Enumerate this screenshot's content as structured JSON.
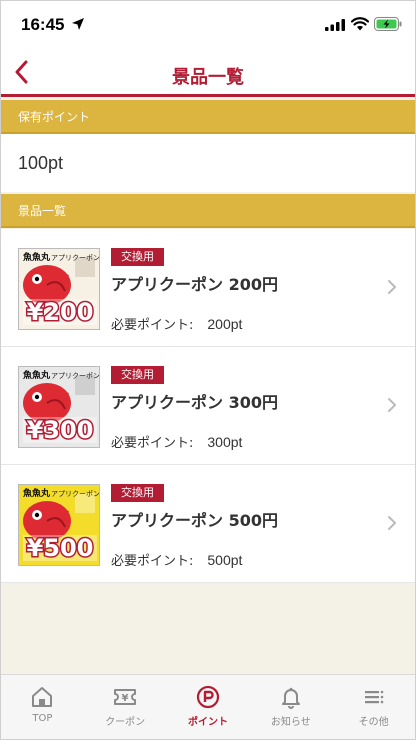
{
  "status_bar": {
    "time": "16:45"
  },
  "header": {
    "title": "景品一覧",
    "back_icon": "chevron-left-icon"
  },
  "points_section": {
    "label": "保有ポイント",
    "value": "100pt"
  },
  "prizes_section": {
    "label": "景品一覧",
    "items": [
      {
        "badge": "交換用",
        "name": "アプリクーポン 200円",
        "points_label": "必要ポイント:",
        "points_value": "200pt",
        "thumb_price": "¥200",
        "thumb_brand": "魚魚丸",
        "thumb_caption": "アプリクーポン",
        "thumb_bg": "#f7f0e4"
      },
      {
        "badge": "交換用",
        "name": "アプリクーポン 300円",
        "points_label": "必要ポイント:",
        "points_value": "300pt",
        "thumb_price": "¥300",
        "thumb_brand": "魚魚丸",
        "thumb_caption": "アプリクーポン",
        "thumb_bg": "#e8e8e8"
      },
      {
        "badge": "交換用",
        "name": "アプリクーポン 500円",
        "points_label": "必要ポイント:",
        "points_value": "500pt",
        "thumb_price": "¥500",
        "thumb_brand": "魚魚丸",
        "thumb_caption": "アプリクーポン",
        "thumb_bg": "#f3dc2a"
      }
    ]
  },
  "tab_bar": {
    "tabs": [
      {
        "label": "TOP",
        "icon": "home-icon",
        "active": false
      },
      {
        "label": "クーポン",
        "icon": "coupon-icon",
        "active": false
      },
      {
        "label": "ポイント",
        "icon": "points-icon",
        "active": true
      },
      {
        "label": "お知らせ",
        "icon": "bell-icon",
        "active": false
      },
      {
        "label": "その他",
        "icon": "menu-icon",
        "active": false
      }
    ]
  },
  "colors": {
    "accent": "#b21d34",
    "section_bar": "#dcb440",
    "background": "#f4f2e6"
  }
}
